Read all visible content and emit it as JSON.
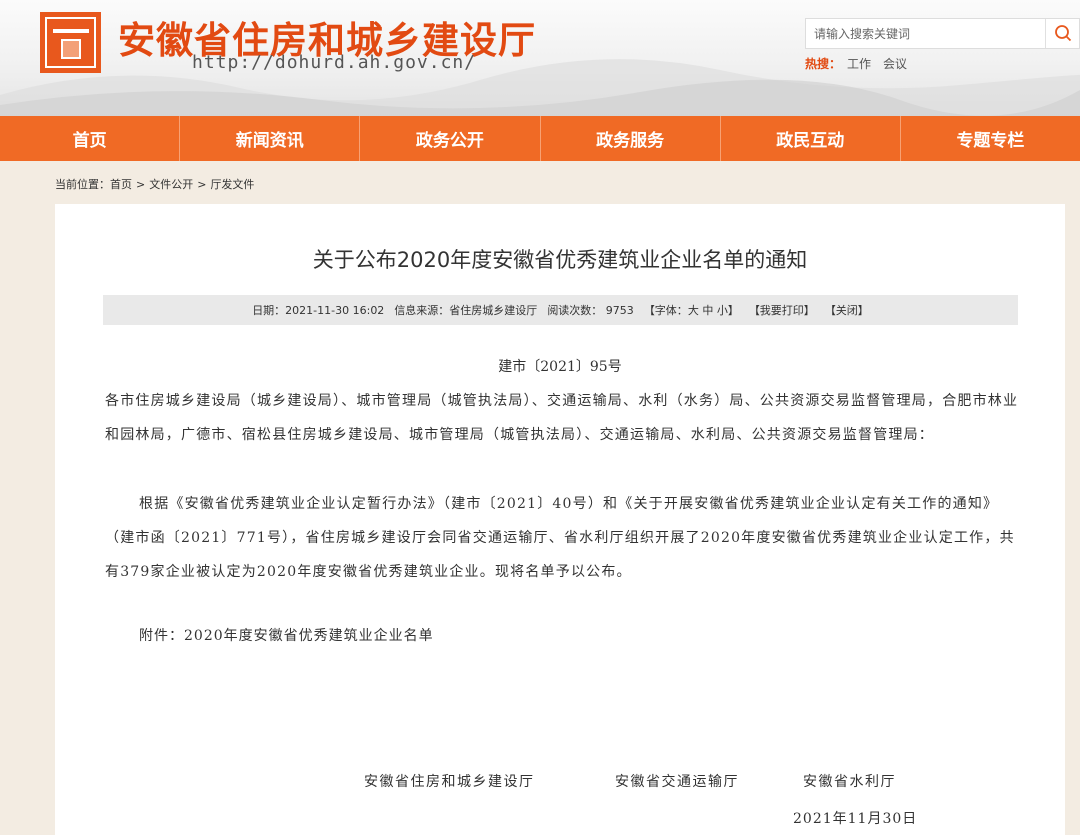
{
  "header": {
    "site_title": "安徽省住房和城乡建设厅",
    "site_url": "http://dohurd.ah.gov.cn/",
    "search_placeholder": "请输入搜索关键词",
    "hot_label": "热搜：",
    "hot_links": [
      "工作",
      "会议"
    ]
  },
  "nav": {
    "items": [
      "首页",
      "新闻资讯",
      "政务公开",
      "政务服务",
      "政民互动",
      "专题专栏"
    ]
  },
  "breadcrumb": {
    "prefix": "当前位置：",
    "items": [
      "首页",
      "文件公开",
      "厅发文件"
    ],
    "separator": ">"
  },
  "article": {
    "title": "关于公布2020年度安徽省优秀建筑业企业名单的通知",
    "info": {
      "date": "日期：2021-11-30 16:02",
      "source": "信息来源：省住房城乡建设厅",
      "views": "阅读次数： 9753",
      "font_prefix": "【字体：",
      "font_large": "大",
      "font_medium": "中",
      "font_small": "小",
      "font_suffix": "】",
      "print": "【我要打印】",
      "close": "【关闭】"
    },
    "doc_no": "建市〔2021〕95号",
    "recipients": "各市住房城乡建设局（城乡建设局）、城市管理局（城管执法局）、交通运输局、水利（水务）局、公共资源交易监督管理局，合肥市林业和园林局，广德市、宿松县住房城乡建设局、城市管理局（城管执法局）、交通运输局、水利局、公共资源交易监督管理局：",
    "paragraph": "根据《安徽省优秀建筑业企业认定暂行办法》（建市〔2021〕40号）和《关于开展安徽省优秀建筑业企业认定有关工作的通知》（建市函〔2021〕771号），省住房城乡建设厅会同省交通运输厅、省水利厅组织开展了2020年度安徽省优秀建筑业企业认定工作，共有379家企业被认定为2020年度安徽省优秀建筑业企业。现将名单予以公布。",
    "attachment": "附件：2020年度安徽省优秀建筑业企业名单",
    "signers": [
      "安徽省住房和城乡建设厅",
      "安徽省交通运输厅",
      "安徽省水利厅"
    ],
    "date": "2021年11月30日"
  },
  "colors": {
    "brand_orange": "#f06a25",
    "title_red": "#e24a12"
  }
}
